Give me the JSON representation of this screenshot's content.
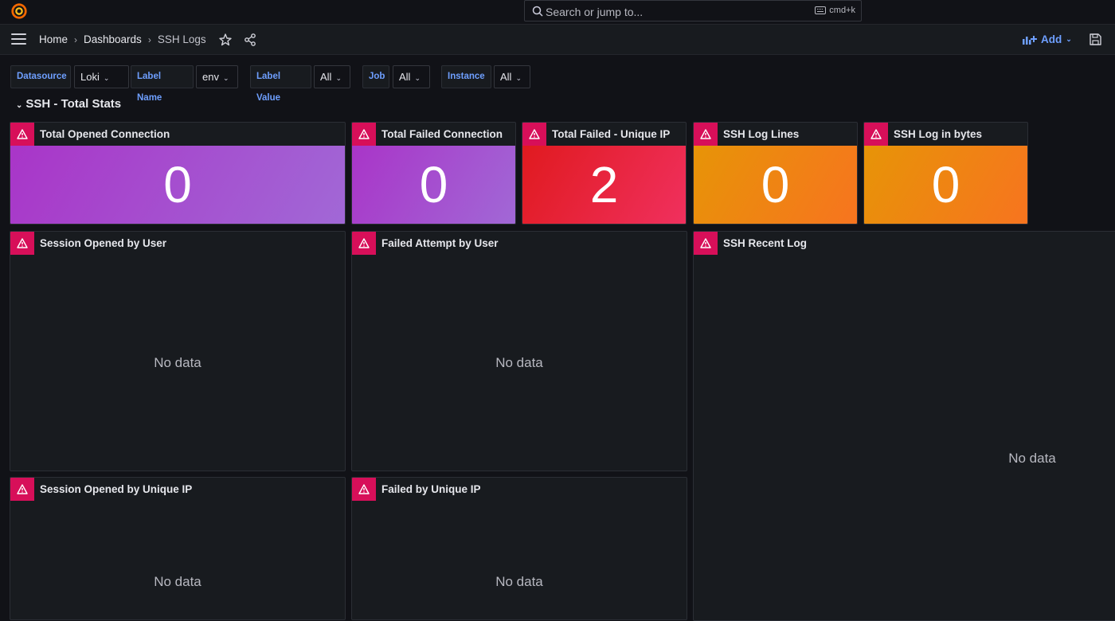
{
  "topbar": {
    "search_placeholder": "Search or jump to...",
    "shortcut": "cmd+k"
  },
  "nav": {
    "crumbs": [
      "Home",
      "Dashboards",
      "SSH Logs"
    ],
    "separator": "›",
    "add_label": "Add"
  },
  "variables": [
    {
      "label": "Datasource",
      "value": "Loki"
    },
    {
      "label": "Label Name",
      "value": "env"
    },
    {
      "label": "Label Value",
      "value": "All"
    },
    {
      "label": "Job",
      "value": "All"
    },
    {
      "label": "Instance",
      "value": "All"
    }
  ],
  "row": {
    "title": "SSH - Total Stats"
  },
  "stats": [
    {
      "title": "Total Opened Connection",
      "value": "0",
      "color": "purple"
    },
    {
      "title": "Total Failed Connection",
      "value": "0",
      "color": "purple"
    },
    {
      "title": "Total Failed - Unique IP",
      "value": "2",
      "color": "red"
    },
    {
      "title": "SSH Log Lines",
      "value": "0",
      "color": "orange"
    },
    {
      "title": "SSH Log in bytes",
      "value": "0",
      "color": "orange"
    }
  ],
  "panels": [
    {
      "title": "Session Opened by User",
      "body": "No data"
    },
    {
      "title": "Failed Attempt by User",
      "body": "No data"
    },
    {
      "title": "SSH Recent Log",
      "body": "No data"
    },
    {
      "title": "Session Opened by Unique IP",
      "body": "No data"
    },
    {
      "title": "Failed by Unique IP",
      "body": "No data"
    }
  ],
  "colors": {
    "background": "#111217",
    "panel": "#181b1f",
    "error": "#d70f59",
    "link": "#6e9fff"
  }
}
